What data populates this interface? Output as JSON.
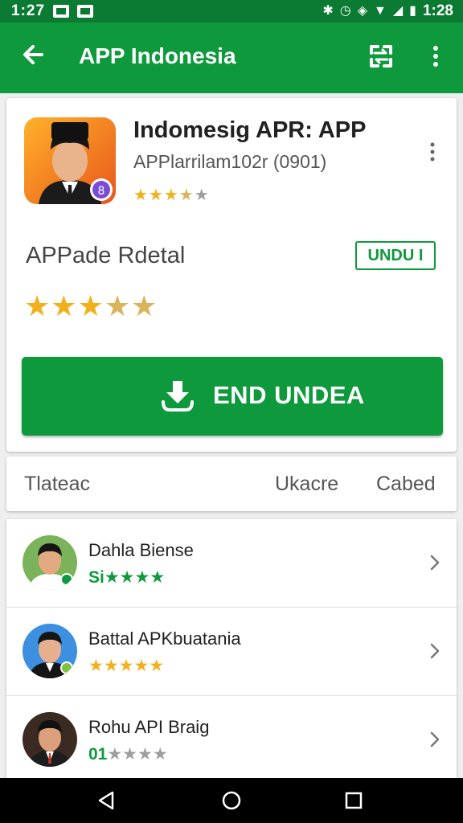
{
  "status_bar": {
    "left_time": "1:27",
    "right_time": "1:28"
  },
  "app_bar": {
    "title": "APP Indonesia",
    "icons": [
      "arrow-left-icon",
      "swap-icon",
      "more-vert-icon"
    ]
  },
  "app_card": {
    "name": "Indomesig APR: APP",
    "subtitle": "APPlarrilam102r (0901)",
    "rating_stars": "★★★★★",
    "rating_value": 3.5,
    "detail_title": "APPade Rdetal",
    "unduh_label": "UNDU I",
    "big_rating_value": 3.5,
    "install_label": "END UNDEA",
    "accent_color": "#0e9a3c",
    "star_color": "#f2b01e"
  },
  "tabs": [
    {
      "label": "Tlateac"
    },
    {
      "label": "Ukacre"
    },
    {
      "label": "Cabed"
    }
  ],
  "list": [
    {
      "name": "Dahla Biense",
      "prefix": "Si",
      "stars": "★★★★",
      "rating_value": 4
    },
    {
      "name": "Battal APKbuatania",
      "prefix": "",
      "stars": "★★★★★",
      "rating_value": 5
    },
    {
      "name": "Rohu API Braig",
      "prefix": "01",
      "stars": "★★★★",
      "rating_value": 1
    }
  ],
  "nav_bar": {
    "icons": [
      "nav-back-icon",
      "nav-home-icon",
      "nav-recent-icon"
    ]
  }
}
